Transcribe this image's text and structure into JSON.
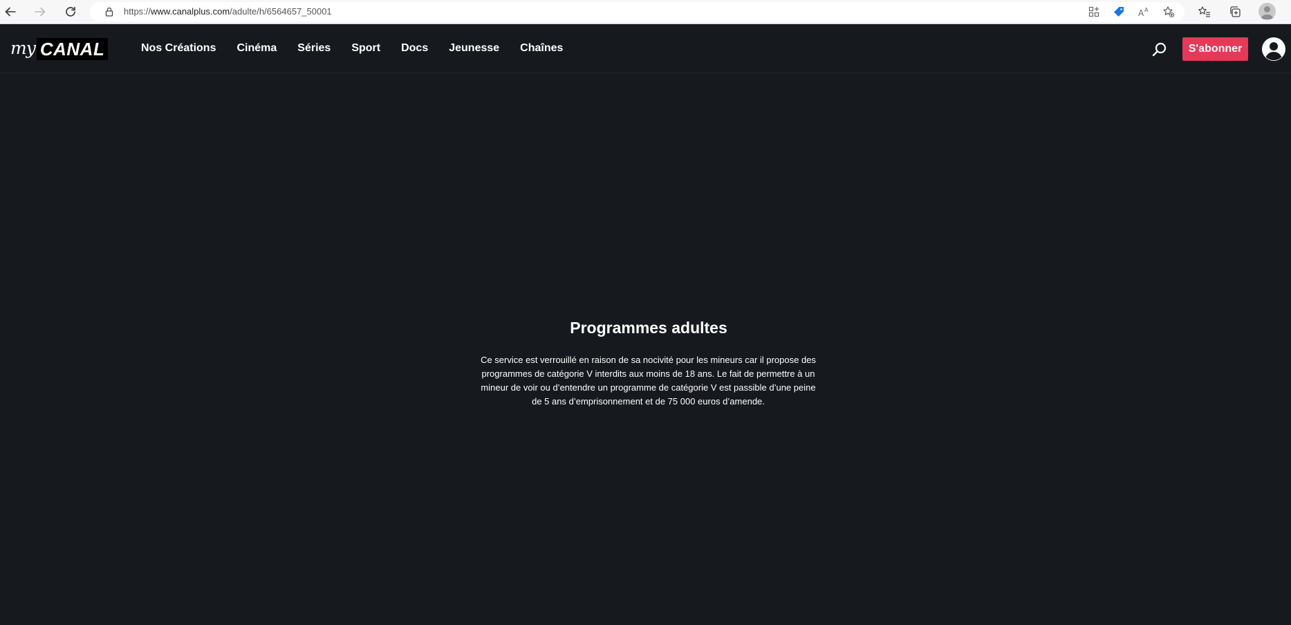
{
  "browser": {
    "url_prefix": "https://",
    "url_host": "www.canalplus.com",
    "url_path": "/adulte/h/6564657_50001"
  },
  "header": {
    "logo_my": "my",
    "logo_canal": "CANAL",
    "nav": [
      {
        "label": "Nos Créations"
      },
      {
        "label": "Cinéma"
      },
      {
        "label": "Séries"
      },
      {
        "label": "Sport"
      },
      {
        "label": "Docs"
      },
      {
        "label": "Jeunesse"
      },
      {
        "label": "Chaînes"
      }
    ],
    "subscribe_label": "S'abonner"
  },
  "main": {
    "title": "Programmes adultes",
    "warning": "Ce service est verrouillé en raison de sa nocivité pour les mineurs car il propose des programmes de catégorie V interdits aux moins de 18 ans. Le fait de permettre à un mineur de voir ou d’entendre un programme de catégorie V est passible d’une peine de 5 ans d’emprisonnement et de 75 000 euros d’amende."
  },
  "colors": {
    "background": "#16191e",
    "accent": "#e53958"
  }
}
